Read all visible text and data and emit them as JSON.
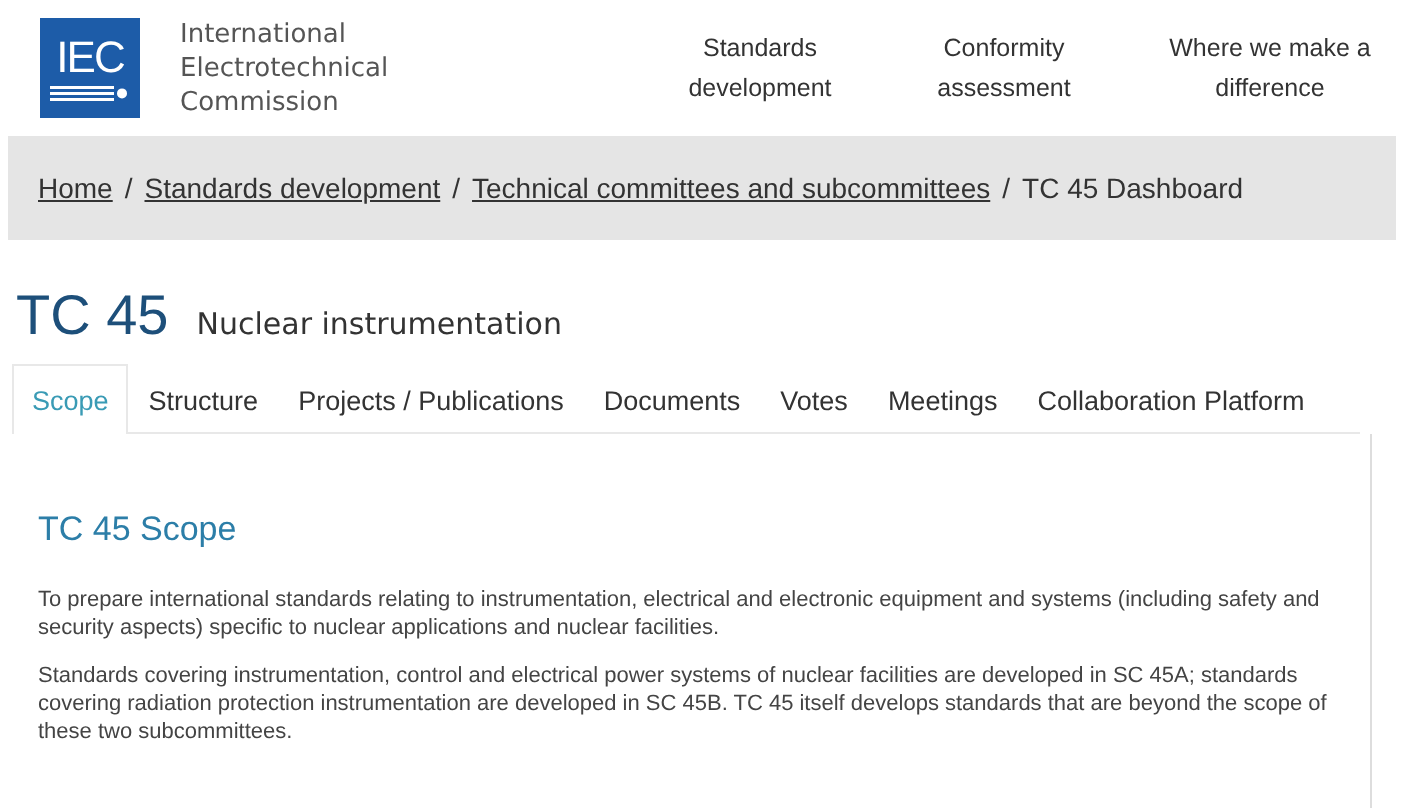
{
  "header": {
    "logo": "IEC",
    "org_name": [
      "International",
      "Electrotechnical",
      "Commission"
    ],
    "nav": [
      "Standards development",
      "Conformity assessment",
      "Where we make a difference"
    ]
  },
  "breadcrumb": {
    "links": [
      "Home",
      "Standards development",
      "Technical committees and subcommittees"
    ],
    "separator": "/",
    "current": "TC 45 Dashboard"
  },
  "committee": {
    "code": "TC 45",
    "name": "Nuclear instrumentation"
  },
  "tabs": [
    {
      "label": "Scope",
      "selected": true
    },
    {
      "label": "Structure",
      "selected": false
    },
    {
      "label": "Projects / Publications",
      "selected": false
    },
    {
      "label": "Documents",
      "selected": false
    },
    {
      "label": "Votes",
      "selected": false
    },
    {
      "label": "Meetings",
      "selected": false
    },
    {
      "label": "Collaboration Platform",
      "selected": false
    }
  ],
  "scope": {
    "heading": "TC 45 Scope",
    "paragraphs": [
      "To prepare international standards relating to instrumentation, electrical and electronic equipment and systems (including safety and security aspects) specific to nuclear applications and nuclear facilities.",
      "Standards covering instrumentation, control and electrical power systems of nuclear facilities are developed in SC 45A; standards covering radiation protection instrumentation are developed in SC 45B. TC 45 itself develops standards that are beyond the scope of these two subcommittees."
    ]
  }
}
